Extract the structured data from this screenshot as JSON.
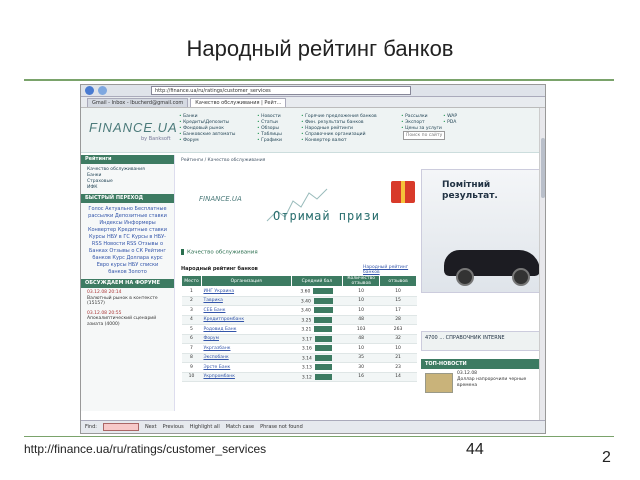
{
  "slide": {
    "title": "Народный рейтинг банков",
    "footer_url": "http://finance.ua/ru/ratings/customer_services",
    "footer_number": "44",
    "page_number": "2"
  },
  "browser": {
    "address": "http://finance.ua/ru/ratings/customer_services",
    "tabs": [
      "Gmail - Inbox - lbucherd@gmail.com",
      "Качество обслуживания | Рейт..."
    ],
    "find_label": "Find:",
    "find_next": "Next",
    "find_previous": "Previous",
    "highlight_all": "Highlight all",
    "match_case": "Match case",
    "phrase_not_found": "Phrase not found"
  },
  "site": {
    "logo": "FINANCE.UA",
    "logo_sub": "by Banksoft",
    "menu_col1": [
      "Банки",
      "Кредиты\\Депозиты",
      "Фондовый рынок",
      "Банковские автоматы",
      "Форум"
    ],
    "menu_col2": [
      "Новости",
      "Статьи",
      "Обзоры",
      "Таблицы",
      "Графики"
    ],
    "menu_col3": [
      "Горячие предложения банков",
      "Фин. результаты банков",
      "Народные рейтинги",
      "Справочник организаций",
      "Конвертер валют"
    ],
    "menu_col4": [
      "Рассылки",
      "Экспорт",
      "Цены за услуги"
    ],
    "menu_col5": [
      "WAP",
      "PDA"
    ],
    "search_placeholder": "Поиск по сайту"
  },
  "left": {
    "section_rating": "Рейтинги",
    "rating_items": [
      "Качество обслуживания",
      "Банки",
      "Страховые",
      "ИФК"
    ],
    "quick_title": "БЫСТРЫЙ ПЕРЕХОД",
    "tags": "Голос Актуально Бесплатные рассылки Депозитные ставки Индексы Информеры Конвертер Кредитные ставки Курсы НБУ в ГС Курсы в НБУ-RSS Новости RSS Отзывы о Банках Отзывы о СК Рейтинг банков Курс Доллара курс Евро курсы НБУ списки банков Золото",
    "forum_title": "ОБСУЖДАЕМ НА ФОРУМЕ",
    "forum_items": [
      {
        "date": "03.12.08 20:14",
        "text": "Валютный рынок в контексте (15157)"
      },
      {
        "date": "03.12.08 20:55",
        "text": "Апокалиптический сценарий азиата (4000)"
      }
    ]
  },
  "main": {
    "breadcrumb": "Рейтинги / Качество обслуживания",
    "banner_logo": "FINANCE.UA",
    "banner_text": "Отримай призи",
    "section_title": "Качество обслуживания",
    "table_title": "Народный рейтинг банков",
    "table_link": "Народный рейтинг банков",
    "columns": [
      "Место",
      "Организация",
      "Средний бал",
      "Количество отзывов",
      "отзывов"
    ],
    "rows": [
      {
        "place": "1",
        "bank": "ИНГ Украина",
        "score": "3.60",
        "bar": 0.9,
        "c1": "10",
        "c2": "10"
      },
      {
        "place": "2",
        "bank": "Таврика",
        "score": "3.40",
        "bar": 0.85,
        "c1": "10",
        "c2": "15"
      },
      {
        "place": "3",
        "bank": "СЕБ Банк",
        "score": "3.40",
        "bar": 0.85,
        "c1": "10",
        "c2": "17"
      },
      {
        "place": "4",
        "bank": "Кредитпромбанк",
        "score": "3.25",
        "bar": 0.81,
        "c1": "48",
        "c2": "28"
      },
      {
        "place": "5",
        "bank": "Родовид Банк",
        "score": "3.21",
        "bar": 0.8,
        "c1": "103",
        "c2": "263"
      },
      {
        "place": "6",
        "bank": "Форум",
        "score": "3.17",
        "bar": 0.79,
        "c1": "48",
        "c2": "32"
      },
      {
        "place": "7",
        "bank": "Укргазбанк",
        "score": "3.16",
        "bar": 0.79,
        "c1": "10",
        "c2": "10"
      },
      {
        "place": "8",
        "bank": "Экспобанк",
        "score": "3.14",
        "bar": 0.78,
        "c1": "35",
        "c2": "21"
      },
      {
        "place": "9",
        "bank": "Эрсте Банк",
        "score": "3.13",
        "bar": 0.78,
        "c1": "30",
        "c2": "23"
      },
      {
        "place": "10",
        "bank": "Укрпромбанк",
        "score": "3.12",
        "bar": 0.78,
        "c1": "16",
        "c2": "14"
      }
    ]
  },
  "right": {
    "ad_text_line1": "Помітний",
    "ad_text_line2": "результат.",
    "ad2_text": "4700 ... СПРАВОЧНИК INTERNE",
    "top_news": "ТОП-НОВОСТИ",
    "news_date": "03.12.08",
    "news_text": "Доллар напророчили черные времена"
  }
}
